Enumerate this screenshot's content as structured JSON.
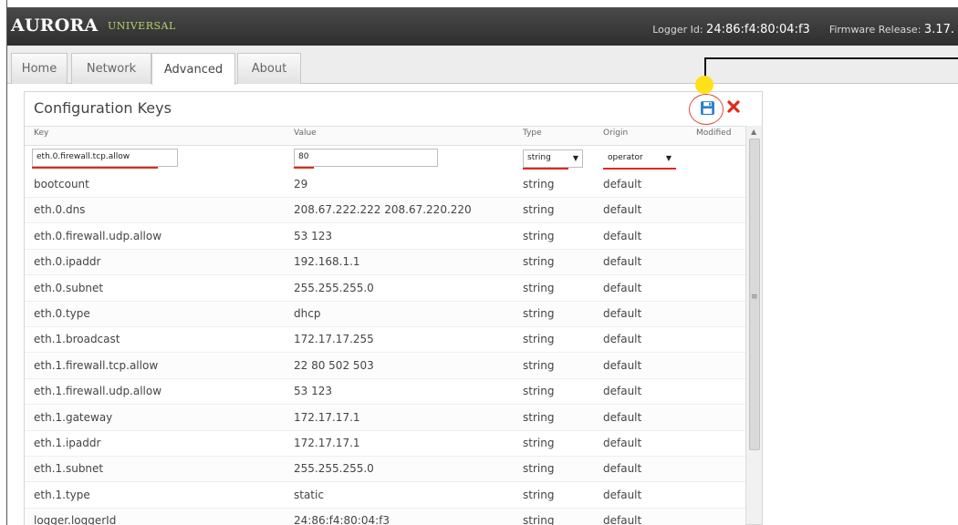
{
  "header": {
    "brand": "AURORA",
    "brand_sub": "UNIVERSAL",
    "logger_label": "Logger Id:",
    "logger_value": "24:86:f4:80:04:f3",
    "firmware_label": "Firmware Release:",
    "firmware_value": "3.17."
  },
  "tabs": [
    {
      "label": "Home"
    },
    {
      "label": "Network"
    },
    {
      "label": "Advanced",
      "active": true
    },
    {
      "label": "About"
    }
  ],
  "panel": {
    "title": "Configuration Keys",
    "save_icon": "save-icon",
    "delete_icon": "delete-icon",
    "columns": {
      "key": "Key",
      "value": "Value",
      "type": "Type",
      "origin": "Origin",
      "modified": "Modified"
    },
    "editor": {
      "key_value": "eth.0.firewall.tcp.allow",
      "value_value": "80",
      "type_value": "string",
      "origin_value": "operator"
    },
    "rows": [
      {
        "key": "bootcount",
        "value": "29",
        "type": "string",
        "origin": "default"
      },
      {
        "key": "eth.0.dns",
        "value": "208.67.222.222 208.67.220.220",
        "type": "string",
        "origin": "default"
      },
      {
        "key": "eth.0.firewall.udp.allow",
        "value": "53 123",
        "type": "string",
        "origin": "default"
      },
      {
        "key": "eth.0.ipaddr",
        "value": "192.168.1.1",
        "type": "string",
        "origin": "default"
      },
      {
        "key": "eth.0.subnet",
        "value": "255.255.255.0",
        "type": "string",
        "origin": "default"
      },
      {
        "key": "eth.0.type",
        "value": "dhcp",
        "type": "string",
        "origin": "default"
      },
      {
        "key": "eth.1.broadcast",
        "value": "172.17.17.255",
        "type": "string",
        "origin": "default"
      },
      {
        "key": "eth.1.firewall.tcp.allow",
        "value": "22 80 502 503",
        "type": "string",
        "origin": "default"
      },
      {
        "key": "eth.1.firewall.udp.allow",
        "value": "53 123",
        "type": "string",
        "origin": "default"
      },
      {
        "key": "eth.1.gateway",
        "value": "172.17.17.1",
        "type": "string",
        "origin": "default"
      },
      {
        "key": "eth.1.ipaddr",
        "value": "172.17.17.1",
        "type": "string",
        "origin": "default"
      },
      {
        "key": "eth.1.subnet",
        "value": "255.255.255.0",
        "type": "string",
        "origin": "default"
      },
      {
        "key": "eth.1.type",
        "value": "static",
        "type": "string",
        "origin": "default"
      },
      {
        "key": "logger.loggerId",
        "value": "24:86:f4:80:04:f3",
        "type": "string",
        "origin": "default"
      }
    ]
  },
  "colors": {
    "header_bg": "#3a3a3a",
    "brand_accent": "#b7d36a",
    "annotation_red": "#e02a1a",
    "callout_yellow": "#ffe11a",
    "save_blue": "#2a7fc9"
  }
}
